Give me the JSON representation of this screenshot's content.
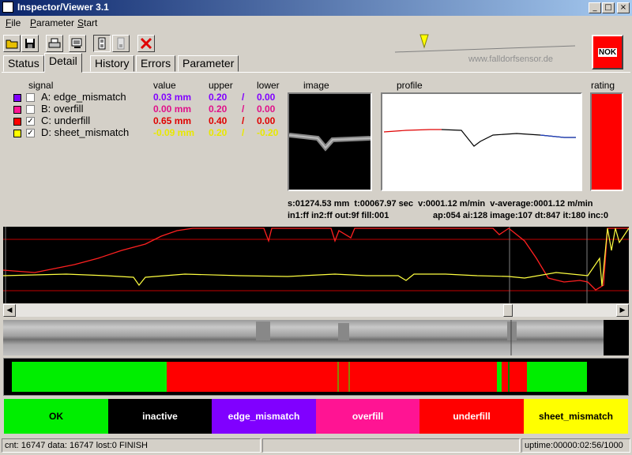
{
  "window": {
    "title": "Inspector/Viewer 3.1",
    "controls": [
      "_",
      "□",
      "×"
    ]
  },
  "menu": [
    "File",
    "Parameter",
    "Start"
  ],
  "toolbar": {
    "nok_label": "NOK",
    "watermark": "www.falldorfsensor.de"
  },
  "tabs": [
    "Status",
    "Detail",
    "History",
    "Errors",
    "Parameter"
  ],
  "active_tab": "Detail",
  "table": {
    "headers": {
      "signal": "signal",
      "value": "value",
      "upper": "upper",
      "lower": "lower"
    },
    "rows": [
      {
        "swatch": "#8000ff",
        "checked": false,
        "name": "A: edge_mismatch",
        "value": "0.03 mm",
        "upper": "0.20",
        "sep": "/",
        "lower": "0.00",
        "color": "#8000ff"
      },
      {
        "swatch": "#ff1493",
        "checked": false,
        "name": "B: overfill",
        "value": "0.00 mm",
        "upper": "0.20",
        "sep": "/",
        "lower": "0.00",
        "color": "#e0108a"
      },
      {
        "swatch": "#ff0000",
        "checked": true,
        "name": "C: underfill",
        "value": "0.65 mm",
        "upper": "0.40",
        "sep": "/",
        "lower": "0.00",
        "color": "#e00000"
      },
      {
        "swatch": "#ffff00",
        "checked": true,
        "name": "D: sheet_mismatch",
        "value": "-0.09 mm",
        "upper": "0.20",
        "sep": "/",
        "lower": "-0.20",
        "color": "#e8e800"
      }
    ]
  },
  "panels": {
    "image": "image",
    "profile": "profile",
    "rating": "rating"
  },
  "stats": {
    "line1a": "s:01274.53 mm",
    "line1b": "t:00067.97 sec",
    "line1c": "v:0001.12 m/min",
    "line1d": "v-average:0001.12 m/min",
    "line2a": "in1:ff in2:ff out:9f fill:001",
    "line2b": "ap:054 ai:128 image:107 dt:847 it:180 inc:0"
  },
  "legend": [
    {
      "label": "OK",
      "bg": "#00ee00",
      "fg": "#000000"
    },
    {
      "label": "inactive",
      "bg": "#000000",
      "fg": "#ffffff"
    },
    {
      "label": "edge_mismatch",
      "bg": "#8000ff",
      "fg": "#ffffff"
    },
    {
      "label": "overfill",
      "bg": "#ff1493",
      "fg": "#ffffff"
    },
    {
      "label": "underfill",
      "bg": "#ff0000",
      "fg": "#ffffff"
    },
    {
      "label": "sheet_mismatch",
      "bg": "#ffff00",
      "fg": "#000000"
    }
  ],
  "status": {
    "left": "cnt: 16747 data: 16747 lost:0 FINISH",
    "middle": "",
    "right": "uptime:00000:02:56/1000"
  },
  "colors": {
    "rating": "#ff0000",
    "ok": "#00ee00",
    "bad": "#ff0000",
    "inactive": "#000000"
  }
}
